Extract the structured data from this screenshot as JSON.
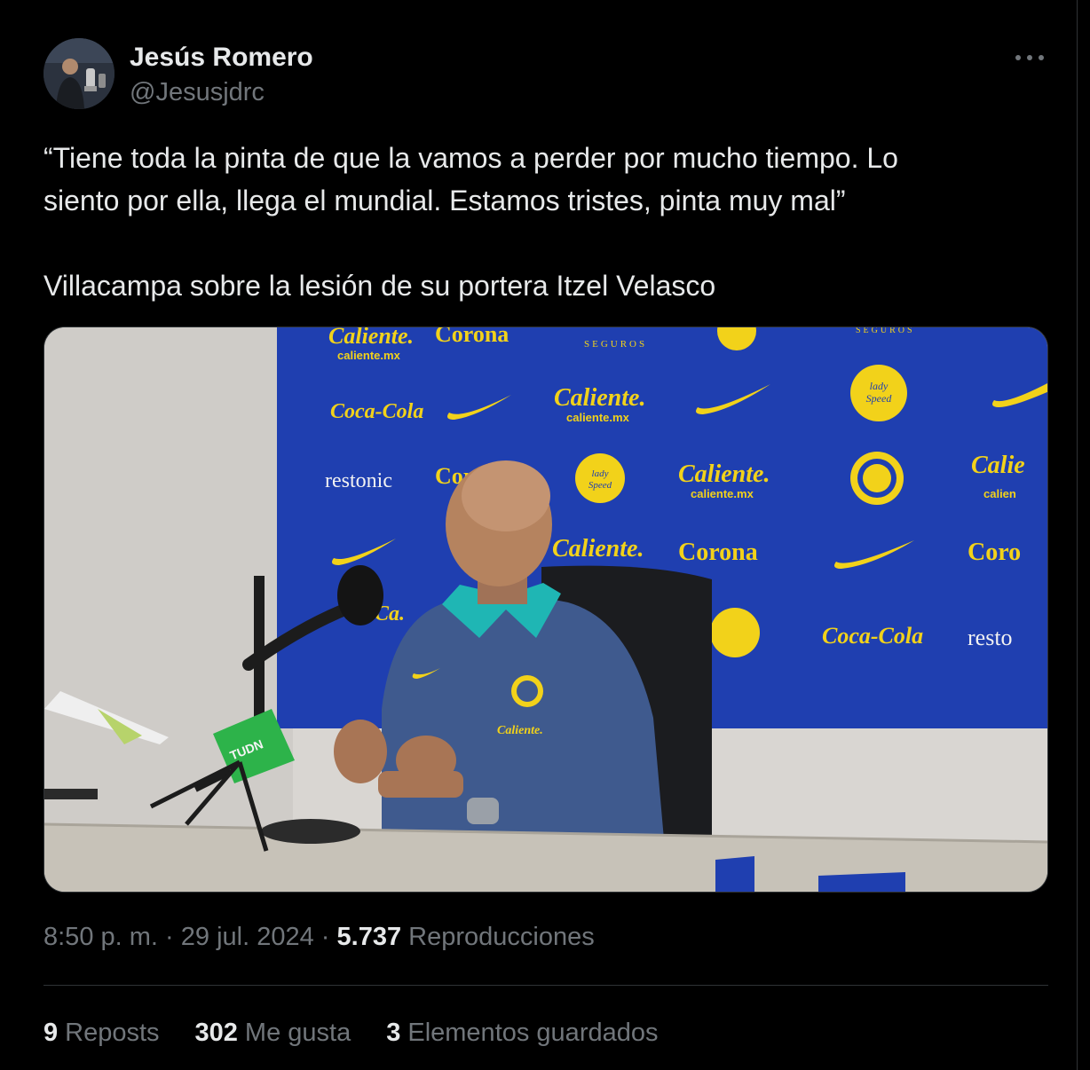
{
  "author": {
    "name": "Jesús Romero",
    "handle": "@Jesusjdrc"
  },
  "tweet": {
    "text_line_1": "“Tiene toda la pinta de que la vamos a perder por mucho tiempo. Lo",
    "text_line_2": "siento por ella, llega el mundial. Estamos tristes, pinta muy mal”",
    "text_line_3": "Villacampa sobre la lesión de su portera Itzel Velasco"
  },
  "media": {
    "backdrop_logos": {
      "caliente": "Caliente.",
      "caliente_url": "caliente.mx",
      "cocacola": "Coca-Cola",
      "corona": "Corona",
      "restonic": "restonic",
      "lady_speed_stick": "lady Speed Stick",
      "seguros": "SEGUROS"
    },
    "mic_label": "TUDN"
  },
  "meta": {
    "time": "8:50 p. m.",
    "separator": "·",
    "date": "29 jul. 2024",
    "views_count": "5.737",
    "views_label": "Reproducciones"
  },
  "stats": {
    "reposts_count": "9",
    "reposts_label": "Reposts",
    "likes_count": "302",
    "likes_label": "Me gusta",
    "bookmarks_count": "3",
    "bookmarks_label": "Elementos guardados"
  },
  "colors": {
    "background": "#000000",
    "text_primary": "#e7e9ea",
    "text_secondary": "#71767b",
    "border": "#2f3336",
    "backdrop_blue": "#1f3fb0",
    "logo_yellow": "#f2d21a"
  },
  "icons": {
    "more": "more-dots-icon"
  }
}
